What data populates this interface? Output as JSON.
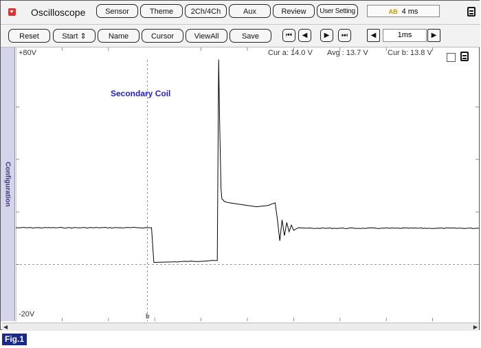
{
  "app": {
    "title": "Oscilloscope",
    "time_per_div": "4 ms",
    "ab_icon": "AB"
  },
  "toolbar1": {
    "sensor": "Sensor",
    "theme": "Theme",
    "channels": "2Ch/4Ch",
    "aux": "Aux",
    "review": "Review",
    "user_setting": "User Setting"
  },
  "toolbar2": {
    "reset": "Reset",
    "start": "Start",
    "start_arrow": "⇕",
    "name": "Name",
    "cursor": "Cursor",
    "view_all": "ViewAll",
    "save": "Save",
    "timebase": "1ms"
  },
  "nav": {
    "first": "⏮",
    "prev": "◀",
    "next": "▶",
    "last": "⏭",
    "dec": "◀",
    "inc": "▶"
  },
  "side_tab": "Configuration",
  "readout": {
    "cur_a": "Cur a: 14.0 V",
    "avg": "Avg  : 13.7 V",
    "cur_b": "Cur b: 13.8 V"
  },
  "plot": {
    "y_max_label": "+80V",
    "y_min_label": "-20V",
    "cursor_b_label": "b",
    "annotation": "Secondary Coil",
    "ylim": [
      -20,
      80
    ],
    "grid": "dotted",
    "trace_color": "#000000",
    "annotation_color": "#1f1fc8"
  },
  "footer": {
    "figure_label": "Fig.1"
  },
  "chart_data": {
    "type": "line",
    "title": "",
    "xlabel": "",
    "ylabel": "",
    "ylim": [
      -20,
      80
    ],
    "xlim": [
      0,
      10
    ],
    "series": [
      {
        "values_x": [
          0,
          2.93,
          2.98,
          3.0,
          3.4,
          4.35,
          4.38,
          4.4,
          4.43,
          4.45,
          4.48,
          4.5,
          4.6,
          4.8,
          5.0,
          5.2,
          5.45,
          5.6,
          5.65,
          5.7,
          5.75,
          5.8,
          5.85,
          5.9,
          5.95,
          6.0,
          6.1,
          6.3,
          10
        ],
        "values_y": [
          14.0,
          14.0,
          0.8,
          0.8,
          1.0,
          1.5,
          78,
          55,
          29,
          25,
          24.5,
          24,
          23.5,
          23,
          22.5,
          22,
          22.5,
          23.5,
          17,
          9,
          17,
          11,
          16,
          12.5,
          15,
          13,
          14,
          13.8,
          13.8
        ]
      }
    ]
  }
}
